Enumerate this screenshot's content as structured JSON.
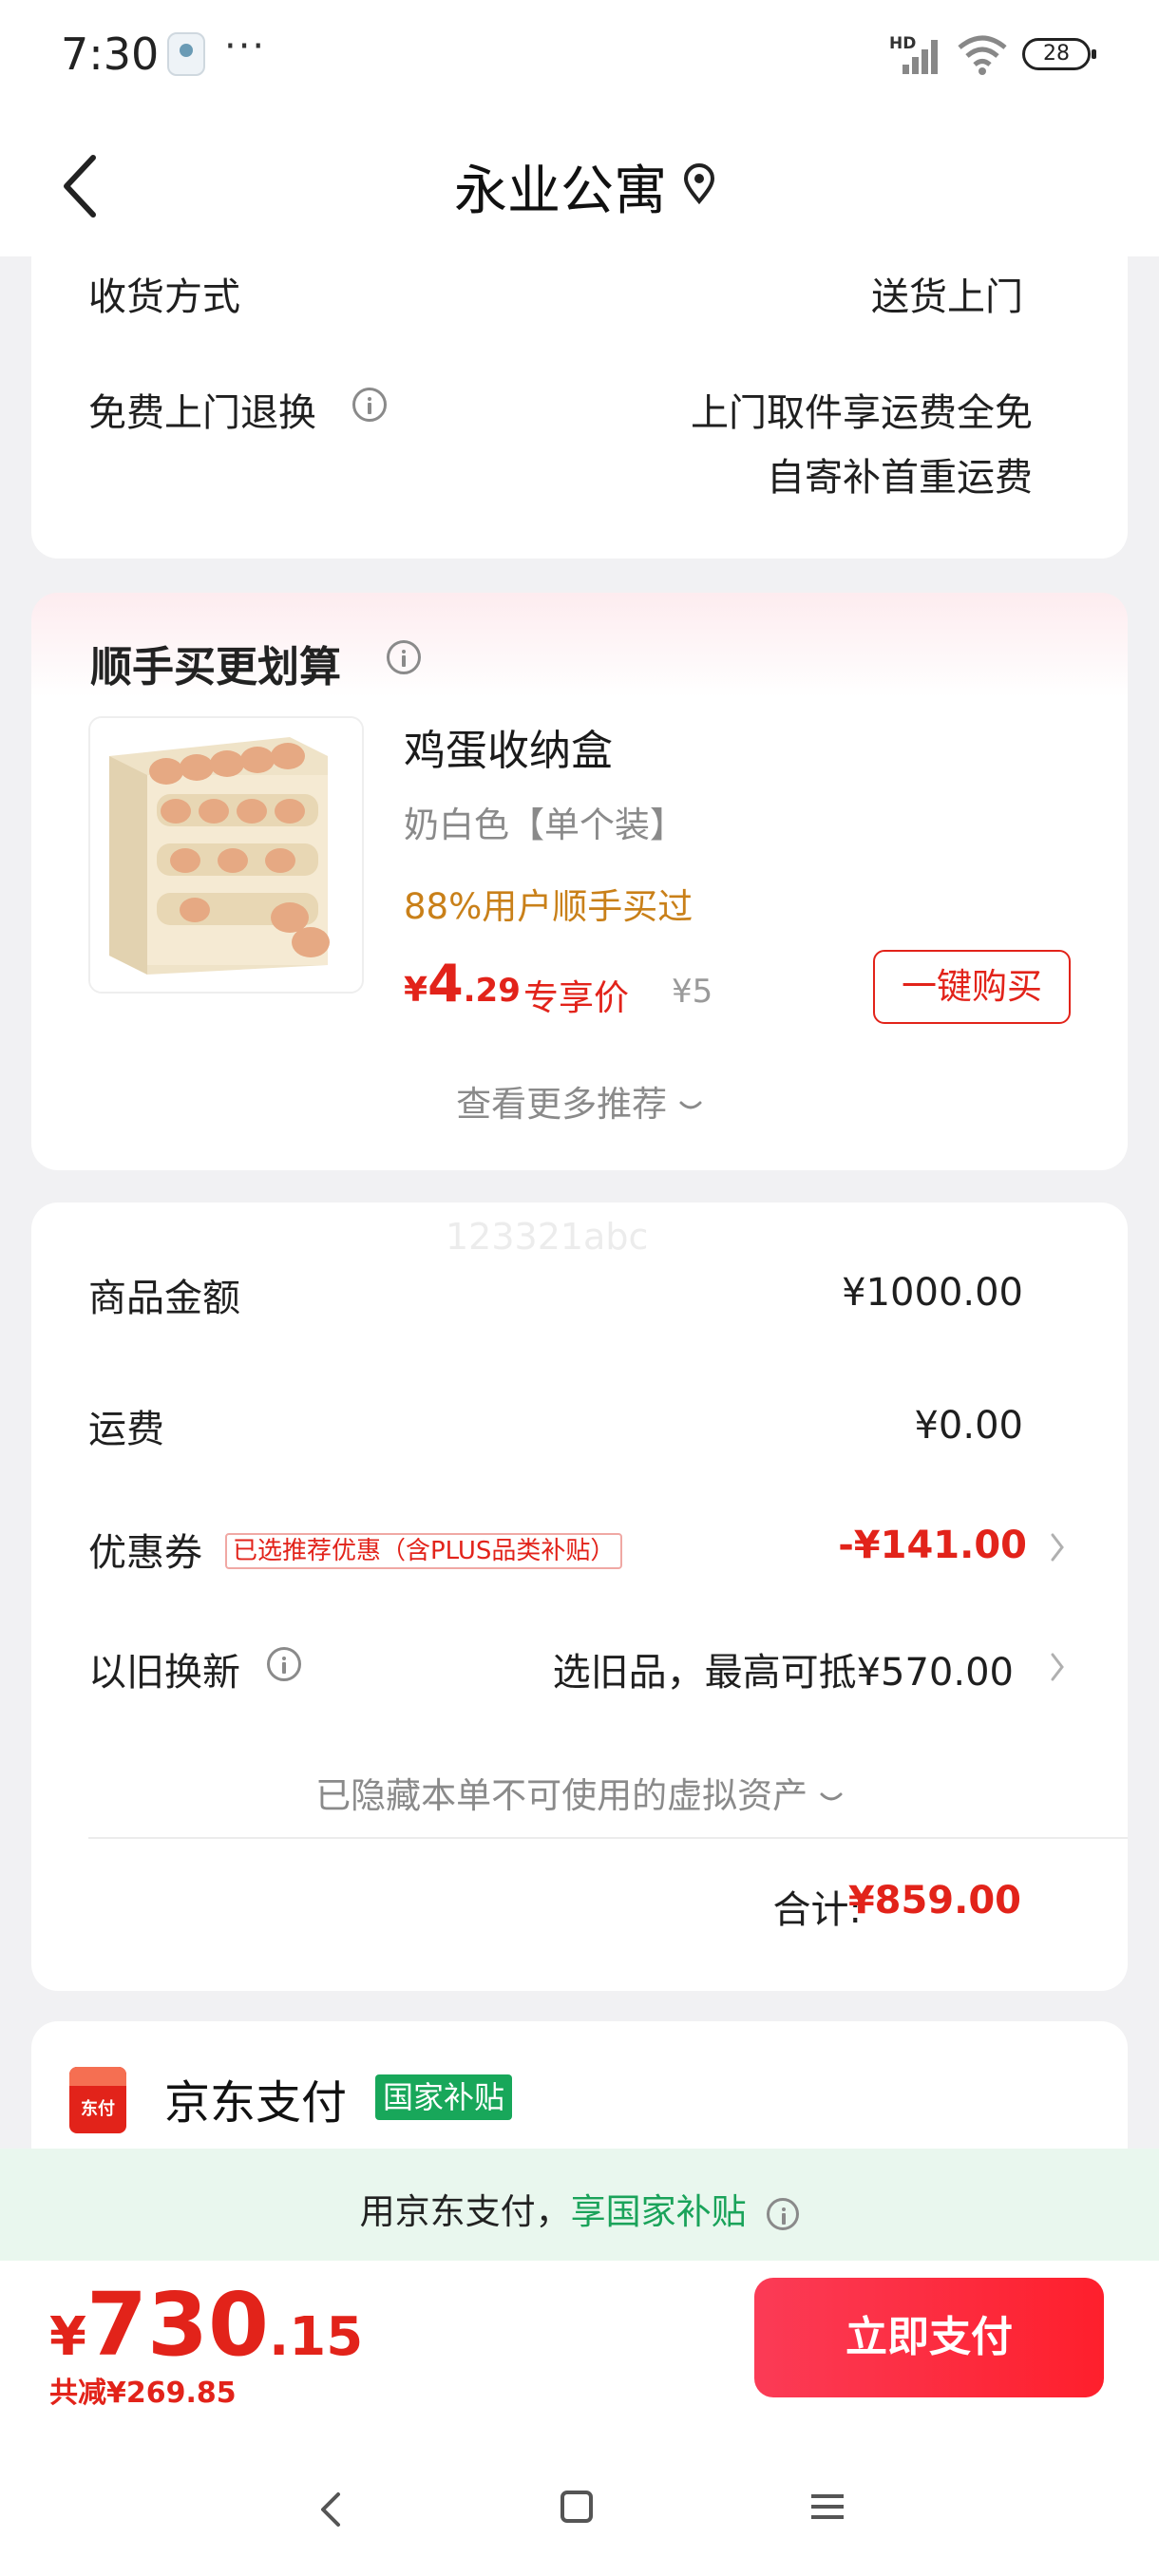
{
  "status_bar": {
    "time": "7:30",
    "dots": "···",
    "network_label": "HD",
    "battery": "28"
  },
  "header": {
    "title": "永业公寓"
  },
  "delivery": {
    "method_label": "收货方式",
    "method_value": "送货上门",
    "return_label": "免费上门退换",
    "return_value_line1": "上门取件享运费全免",
    "return_value_line2": "自寄补首重运费"
  },
  "recommend": {
    "title": "顺手买更划算",
    "product": {
      "name": "鸡蛋收纳盒",
      "spec": "奶白色【单个装】",
      "social_proof": "88%用户顺手买过",
      "price_currency": "¥",
      "price_int": "4",
      "price_dec": ".29",
      "price_label": "专享价",
      "original_price": "¥5",
      "buy_button": "一键购买"
    },
    "more_link": "查看更多推荐"
  },
  "summary": {
    "watermark": "123321abc",
    "goods_label": "商品金额",
    "goods_value": "¥1000.00",
    "shipping_label": "运费",
    "shipping_value": "¥0.00",
    "coupon_label": "优惠券",
    "coupon_tag": "已选推荐优惠（含PLUS品类补贴）",
    "coupon_value": "-¥141.00",
    "tradein_label": "以旧换新",
    "tradein_value": "选旧品，最高可抵¥570.00",
    "hidden_assets": "已隐藏本单不可使用的虚拟资产",
    "total_label": "合计:",
    "total_value": "¥859.00"
  },
  "payment": {
    "logo_text": "东付",
    "name": "京东支付",
    "badge": "国家补贴"
  },
  "subsidy_banner": {
    "prefix": "用京东支付，",
    "highlight": "享国家补贴"
  },
  "bottom_bar": {
    "price_currency": "¥",
    "price_int": "730",
    "price_dec": ".15",
    "saving": "共减¥269.85",
    "pay_button": "立即支付"
  },
  "colors": {
    "accent_red": "#e2231a",
    "social_orange": "#c98019",
    "subsidy_green": "#18a75a"
  }
}
